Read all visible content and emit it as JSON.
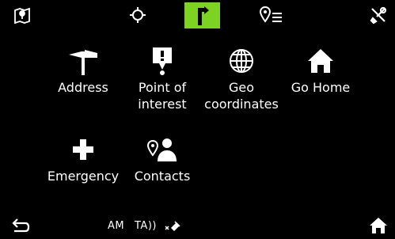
{
  "top_bar": {
    "icons": [
      "map-book-icon",
      "crosshair-icon",
      "turn-icon",
      "poi-list-icon",
      "tools-icon"
    ]
  },
  "destinations": [
    {
      "label": "Address",
      "icon": "signpost-icon"
    },
    {
      "label": "Point of\ninterest",
      "icon": "poi-flag-icon"
    },
    {
      "label": "Geo\ncoordinates",
      "icon": "globe-icon"
    },
    {
      "label": "Go Home",
      "icon": "home-icon"
    },
    {
      "label": "Emergency",
      "icon": "cross-icon"
    },
    {
      "label": "Contacts",
      "icon": "contacts-icon"
    }
  ],
  "status_bar": {
    "am_label": "AM",
    "ta_label": "TA))"
  },
  "colors": {
    "background": "#000000",
    "active_tab": "#7cd322"
  }
}
